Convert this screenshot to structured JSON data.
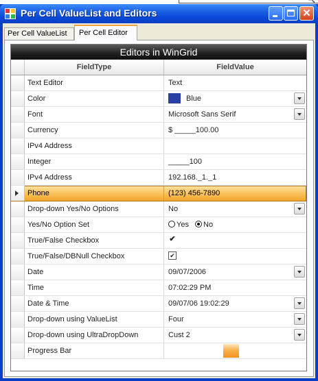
{
  "window": {
    "title": "Per Cell ValueList and Editors"
  },
  "tabs": [
    {
      "label": "Per Cell ValueList",
      "active": false
    },
    {
      "label": "Per Cell Editor",
      "active": true
    }
  ],
  "grid": {
    "caption": "Editors in WinGrid",
    "columns": {
      "field_type": "FieldType",
      "field_value": "FieldValue"
    },
    "rows": [
      {
        "type": "Text Editor",
        "value": "Text"
      },
      {
        "type": "Color",
        "value": "Blue",
        "swatch": "#2a3fa6",
        "dropdown": true
      },
      {
        "type": "Font",
        "value": "Microsoft Sans Serif",
        "dropdown": true
      },
      {
        "type": "Currency",
        "value": "$ _____100.00"
      },
      {
        "type": "IPv4 Address",
        "value": ""
      },
      {
        "type": "Integer",
        "value": "_____100"
      },
      {
        "type": "IPv4 Address",
        "value": "192.168._1._1"
      },
      {
        "type": "Phone",
        "value": "(123) 456-7890",
        "active": true
      },
      {
        "type": "Drop-down Yes/No Options",
        "value": "No",
        "dropdown": true
      },
      {
        "type": "Yes/No Option Set",
        "options": [
          "Yes",
          "No"
        ],
        "selected": "No"
      },
      {
        "type": "True/False Checkbox",
        "checked": true
      },
      {
        "type": "True/False/DBNull Checkbox",
        "checked": true
      },
      {
        "type": "Date",
        "value": "09/07/2006",
        "dropdown": true
      },
      {
        "type": "Time",
        "value": "07:02:29 PM"
      },
      {
        "type": "Date & Time",
        "value": "09/07/06 19:02:29",
        "dropdown": true
      },
      {
        "type": "Drop-down using ValueList",
        "value": "Four",
        "dropdown": true
      },
      {
        "type": "Drop-down using UltraDropDown",
        "value": "Cust 2",
        "dropdown": true
      },
      {
        "type": "Progress Bar",
        "progress": 0.5
      }
    ]
  },
  "colors": {
    "titlebar": "#0a48d8",
    "active_row": "#fbc05c",
    "swatch_blue": "#2a3fa6"
  }
}
